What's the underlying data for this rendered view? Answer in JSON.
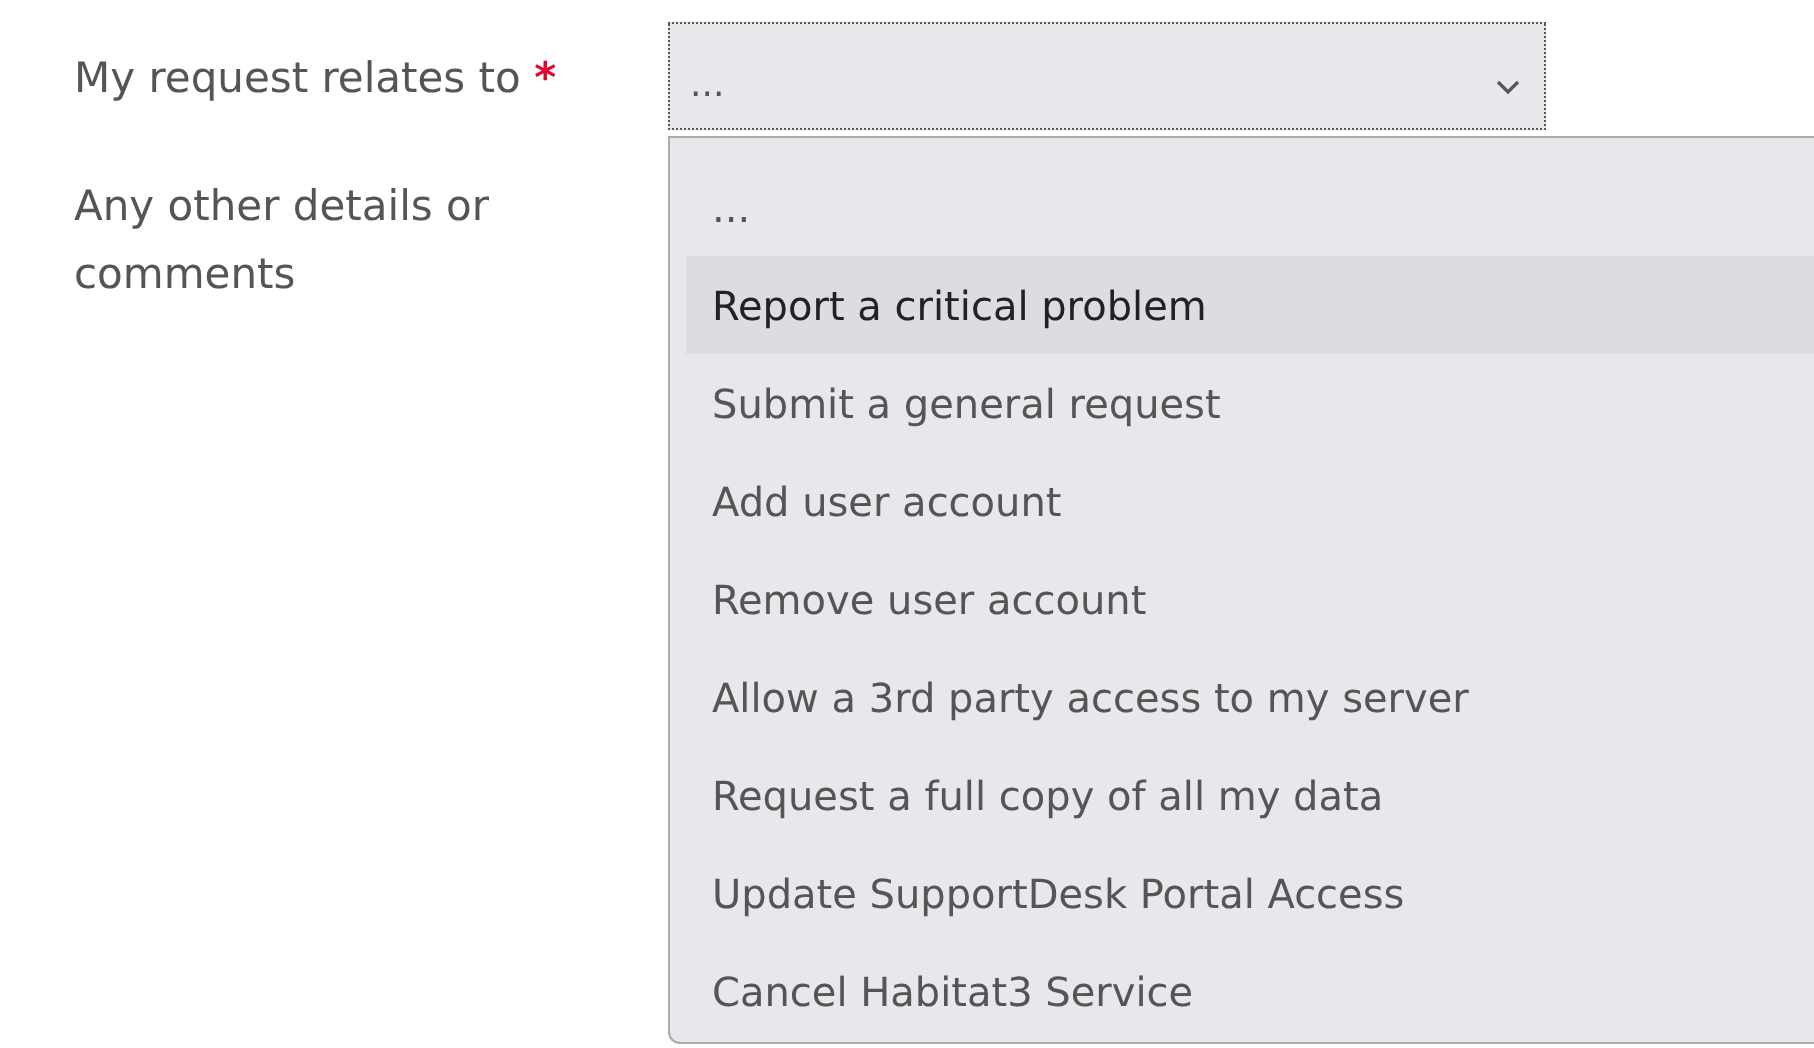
{
  "fields": [
    {
      "label": "My request relates to",
      "required": true
    },
    {
      "label": "Any other details or comments",
      "required": false
    }
  ],
  "required_mark": "*",
  "select": {
    "value": "...",
    "expanded": true
  },
  "options": [
    {
      "label": "...",
      "selected": false
    },
    {
      "label": "Report a critical problem",
      "selected": true
    },
    {
      "label": "Submit a general request",
      "selected": false
    },
    {
      "label": "Add user account",
      "selected": false
    },
    {
      "label": "Remove user account",
      "selected": false
    },
    {
      "label": "Allow a 3rd party access to my server",
      "selected": false
    },
    {
      "label": "Request a full copy of all my data",
      "selected": false
    },
    {
      "label": "Update SupportDesk Portal Access",
      "selected": false
    },
    {
      "label": "Cancel Habitat3 Service",
      "selected": false
    }
  ]
}
